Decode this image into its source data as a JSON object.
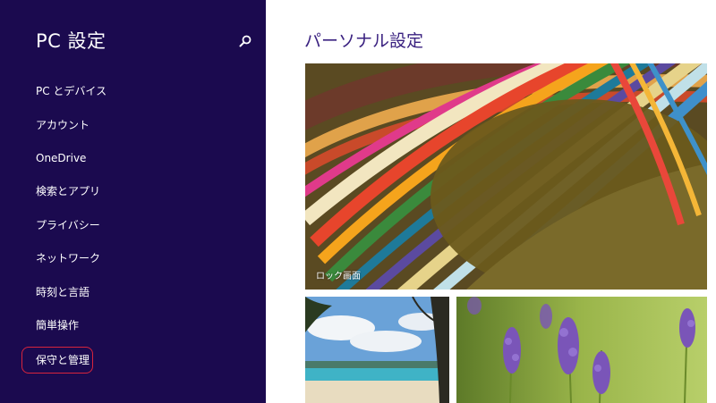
{
  "sidebar": {
    "title": "PC 設定",
    "items": [
      {
        "label": "PC とデバイス"
      },
      {
        "label": "アカウント"
      },
      {
        "label": "OneDrive"
      },
      {
        "label": "検索とアプリ"
      },
      {
        "label": "プライバシー"
      },
      {
        "label": "ネットワーク"
      },
      {
        "label": "時刻と言語"
      },
      {
        "label": "簡単操作"
      },
      {
        "label": "保守と管理"
      }
    ],
    "search_icon": "search-icon",
    "highlighted_item": "保守と管理"
  },
  "main": {
    "title": "パーソナル設定",
    "tiles": [
      {
        "label": "ロック画面",
        "image": "colored-paper-strips"
      },
      {
        "image": "beach-scene"
      },
      {
        "image": "lavender-flowers"
      }
    ]
  },
  "colors": {
    "sidebar_bg": "#1b0a4f",
    "title_accent": "#3a2180",
    "highlight_outline": "#d8243c"
  }
}
